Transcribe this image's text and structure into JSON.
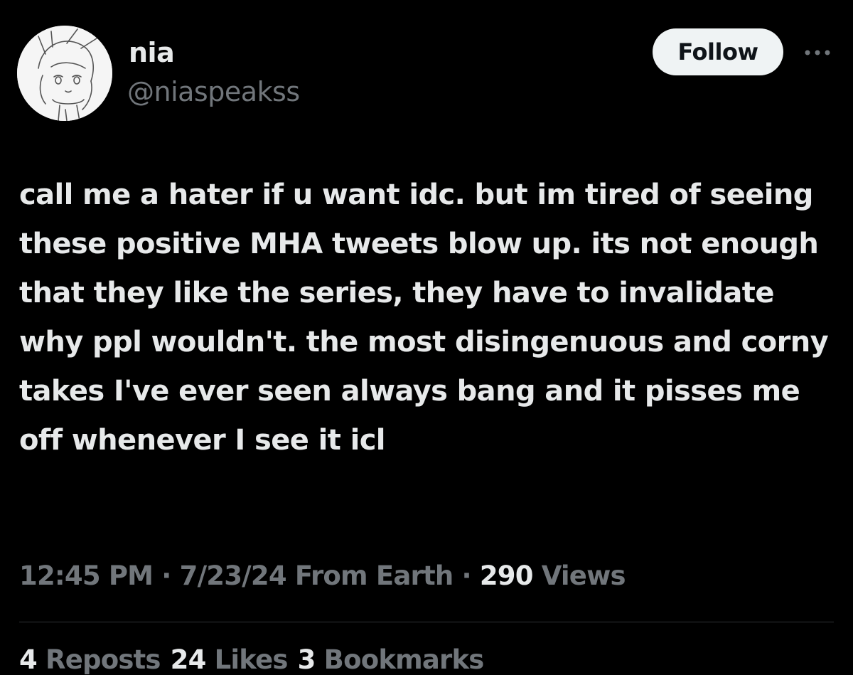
{
  "author": {
    "display_name": "nia",
    "handle": "@niaspeakss",
    "avatar": "anime-girl-sketch-avatar"
  },
  "actions": {
    "follow_label": "Follow",
    "more_icon": "more-horizontal-icon"
  },
  "tweet": {
    "text": "call me a hater if u want idc. but im tired of seeing these positive MHA tweets blow up. its not enough that they like the series, they have to invalidate why ppl wouldn't. the most disingenuous and corny takes I've ever seen always bang and it pisses me off whenever I see it icl"
  },
  "meta": {
    "time": "12:45 PM",
    "sep1": " · ",
    "date_source": "7/23/24 From Earth",
    "sep2": " · ",
    "views_count": "290",
    "views_label": " Views"
  },
  "stats": {
    "reposts_count": "4",
    "reposts_label": " Reposts",
    "likes_count": "24",
    "likes_label": " Likes",
    "bookmarks_count": "3",
    "bookmarks_label": " Bookmarks"
  },
  "colors": {
    "background": "#000000",
    "primary_text": "#e7e9ea",
    "secondary_text": "#71767b",
    "follow_bg": "#eff3f4",
    "divider": "#2f3336"
  }
}
